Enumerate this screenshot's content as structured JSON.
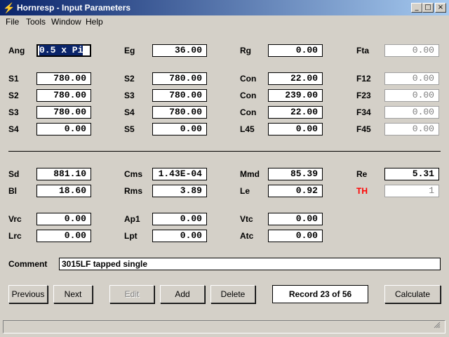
{
  "window": {
    "title": "Hornresp - Input Parameters",
    "minimize_glyph": "_",
    "maximize_glyph": "□",
    "close_glyph": "×",
    "app_icon_glyph": "⚡"
  },
  "menu": [
    "File",
    "Tools",
    "Window",
    "Help"
  ],
  "params": {
    "ang": {
      "label": "Ang",
      "value": "0.5 x Pi"
    },
    "eg": {
      "label": "Eg",
      "value": "36.00"
    },
    "rg": {
      "label": "Rg",
      "value": "0.00"
    },
    "fta": {
      "label": "Fta",
      "value": "0.00"
    },
    "s1": {
      "label": "S1",
      "value": "780.00"
    },
    "s2a": {
      "label": "S2",
      "value": "780.00"
    },
    "con1": {
      "label": "Con",
      "value": "22.00"
    },
    "f12": {
      "label": "F12",
      "value": "0.00"
    },
    "s2": {
      "label": "S2",
      "value": "780.00"
    },
    "s3a": {
      "label": "S3",
      "value": "780.00"
    },
    "con2": {
      "label": "Con",
      "value": "239.00"
    },
    "f23": {
      "label": "F23",
      "value": "0.00"
    },
    "s3": {
      "label": "S3",
      "value": "780.00"
    },
    "s4a": {
      "label": "S4",
      "value": "780.00"
    },
    "con3": {
      "label": "Con",
      "value": "22.00"
    },
    "f34": {
      "label": "F34",
      "value": "0.00"
    },
    "s4": {
      "label": "S4",
      "value": "0.00"
    },
    "s5": {
      "label": "S5",
      "value": "0.00"
    },
    "l45": {
      "label": "L45",
      "value": "0.00"
    },
    "f45": {
      "label": "F45",
      "value": "0.00"
    },
    "sd": {
      "label": "Sd",
      "value": "881.10"
    },
    "cms": {
      "label": "Cms",
      "value": "1.43E-04"
    },
    "mmd": {
      "label": "Mmd",
      "value": "85.39"
    },
    "re": {
      "label": "Re",
      "value": "5.31"
    },
    "bl": {
      "label": "Bl",
      "value": "18.60"
    },
    "rms": {
      "label": "Rms",
      "value": "3.89"
    },
    "le": {
      "label": "Le",
      "value": "0.92"
    },
    "th": {
      "label": "TH",
      "value": "1"
    },
    "vrc": {
      "label": "Vrc",
      "value": "0.00"
    },
    "ap1": {
      "label": "Ap1",
      "value": "0.00"
    },
    "vtc": {
      "label": "Vtc",
      "value": "0.00"
    },
    "lrc": {
      "label": "Lrc",
      "value": "0.00"
    },
    "lpt": {
      "label": "Lpt",
      "value": "0.00"
    },
    "atc": {
      "label": "Atc",
      "value": "0.00"
    }
  },
  "comment": {
    "label": "Comment",
    "value": "3015LF tapped single"
  },
  "buttons": {
    "previous": "Previous",
    "next": "Next",
    "edit": "Edit",
    "add": "Add",
    "delete": "Delete",
    "calculate": "Calculate"
  },
  "record": "Record 23 of 56",
  "colors": {
    "title_start": "#0a246a",
    "title_end": "#a6caf0",
    "th_label": "#ff0000",
    "face": "#d4d0c8"
  }
}
